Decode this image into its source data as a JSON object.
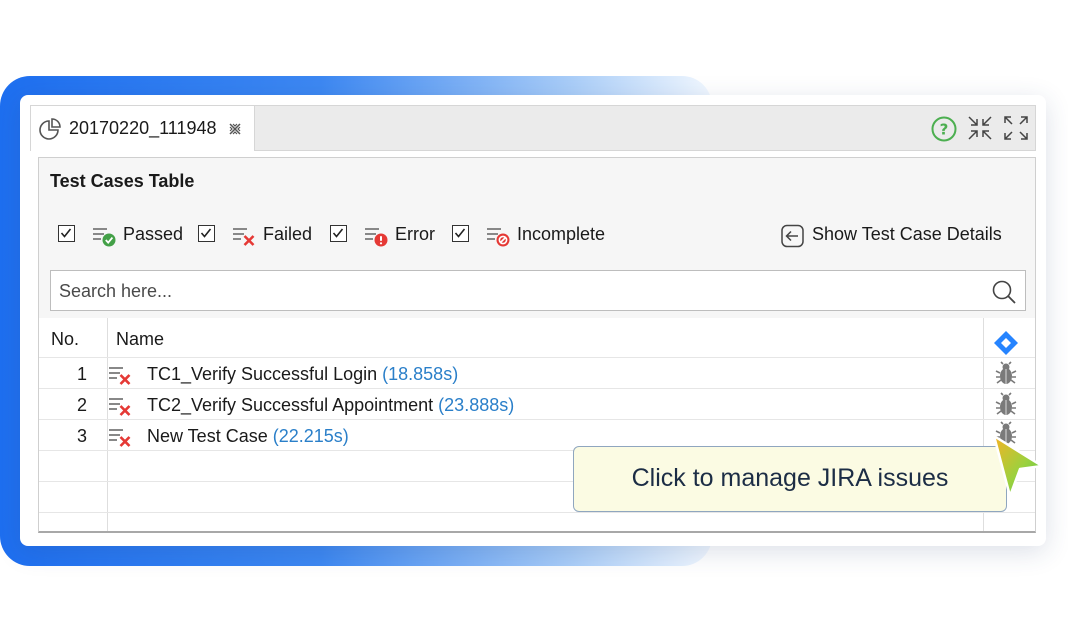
{
  "tab": {
    "title": "20170220_111948"
  },
  "panel": {
    "title": "Test Cases Table"
  },
  "filters": [
    {
      "label": "Passed",
      "checked": true,
      "icon": "passed-icon"
    },
    {
      "label": "Failed",
      "checked": true,
      "icon": "failed-icon"
    },
    {
      "label": "Error",
      "checked": true,
      "icon": "error-icon"
    },
    {
      "label": "Incomplete",
      "checked": true,
      "icon": "incomplete-icon"
    }
  ],
  "details_button": {
    "label": "Show Test Case Details"
  },
  "search": {
    "placeholder": "Search here..."
  },
  "table": {
    "headers": {
      "no": "No.",
      "name": "Name"
    },
    "rows": [
      {
        "no": "1",
        "name": "TC1_Verify Successful Login",
        "duration": "(18.858s)",
        "status": "failed"
      },
      {
        "no": "2",
        "name": "TC2_Verify Successful Appointment",
        "duration": "(23.888s)",
        "status": "failed"
      },
      {
        "no": "3",
        "name": "New Test Case",
        "duration": "(22.215s)",
        "status": "failed"
      }
    ]
  },
  "tooltip": {
    "text": "Click to manage JIRA issues"
  },
  "colors": {
    "accent_blue": "#1e6ff0",
    "fail_red": "#e53935",
    "pass_green": "#43a047",
    "duration_blue": "#2a7fc9",
    "tooltip_bg": "#fbfbe3"
  }
}
